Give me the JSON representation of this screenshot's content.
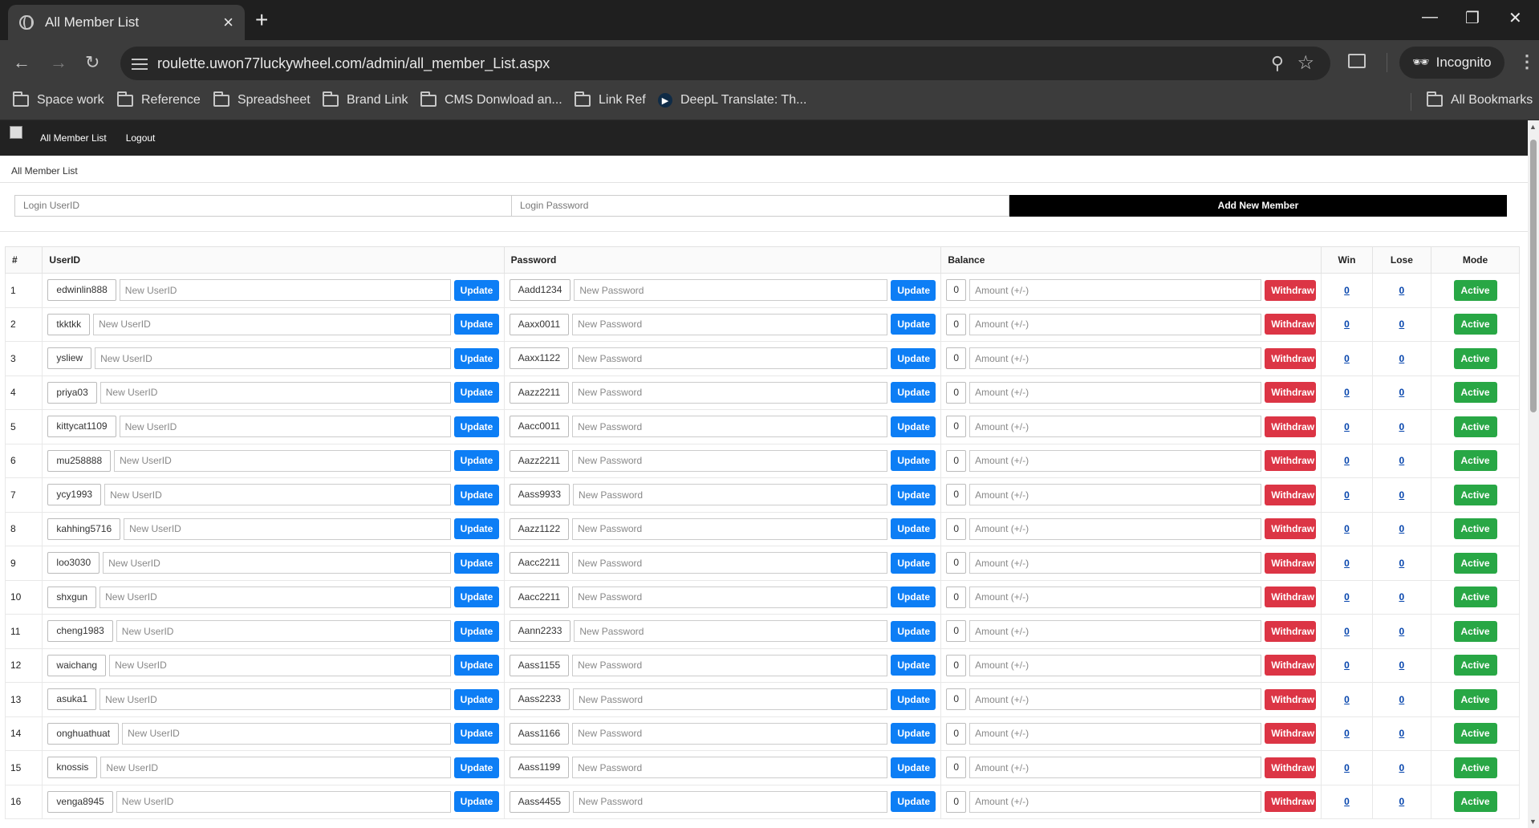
{
  "browser": {
    "tab_title": "All Member List",
    "url": "roulette.uwon77luckywheel.com/admin/all_member_List.aspx",
    "incognito_label": "Incognito",
    "bookmarks": [
      "Space work",
      "Reference",
      "Spreadsheet",
      "Brand Link",
      "CMS Donwload an...",
      "Link Ref",
      "DeepL Translate: Th..."
    ],
    "all_bookmarks_label": "All Bookmarks"
  },
  "app": {
    "nav": [
      "All Member List",
      "Logout"
    ],
    "breadcrumb": "All Member List",
    "add_form": {
      "userid_placeholder": "Login UserID",
      "password_placeholder": "Login Password",
      "add_button": "Add New Member"
    },
    "table": {
      "headers": [
        "#",
        "UserID",
        "Password",
        "Balance",
        "Win",
        "Lose",
        "Mode"
      ],
      "placeholders": {
        "userid": "New UserID",
        "password": "New Password",
        "amount": "Amount (+/-)"
      },
      "labels": {
        "update": "Update",
        "withdraw": "Withdraw",
        "mode": "Active"
      },
      "rows": [
        {
          "no": "1",
          "userid": "edwinlin888",
          "password": "Aadd1234",
          "balance": "0",
          "win": "0",
          "lose": "0"
        },
        {
          "no": "2",
          "userid": "tkktkk",
          "password": "Aaxx0011",
          "balance": "0",
          "win": "0",
          "lose": "0"
        },
        {
          "no": "3",
          "userid": "ysliew",
          "password": "Aaxx1122",
          "balance": "0",
          "win": "0",
          "lose": "0"
        },
        {
          "no": "4",
          "userid": "priya03",
          "password": "Aazz2211",
          "balance": "0",
          "win": "0",
          "lose": "0"
        },
        {
          "no": "5",
          "userid": "kittycat1109",
          "password": "Aacc0011",
          "balance": "0",
          "win": "0",
          "lose": "0"
        },
        {
          "no": "6",
          "userid": "mu258888",
          "password": "Aazz2211",
          "balance": "0",
          "win": "0",
          "lose": "0"
        },
        {
          "no": "7",
          "userid": "ycy1993",
          "password": "Aass9933",
          "balance": "0",
          "win": "0",
          "lose": "0"
        },
        {
          "no": "8",
          "userid": "kahhing5716",
          "password": "Aazz1122",
          "balance": "0",
          "win": "0",
          "lose": "0"
        },
        {
          "no": "9",
          "userid": "loo3030",
          "password": "Aacc2211",
          "balance": "0",
          "win": "0",
          "lose": "0"
        },
        {
          "no": "10",
          "userid": "shxgun",
          "password": "Aacc2211",
          "balance": "0",
          "win": "0",
          "lose": "0"
        },
        {
          "no": "11",
          "userid": "cheng1983",
          "password": "Aann2233",
          "balance": "0",
          "win": "0",
          "lose": "0"
        },
        {
          "no": "12",
          "userid": "waichang",
          "password": "Aass1155",
          "balance": "0",
          "win": "0",
          "lose": "0"
        },
        {
          "no": "13",
          "userid": "asuka1",
          "password": "Aass2233",
          "balance": "0",
          "win": "0",
          "lose": "0"
        },
        {
          "no": "14",
          "userid": "onghuathuat",
          "password": "Aass1166",
          "balance": "0",
          "win": "0",
          "lose": "0"
        },
        {
          "no": "15",
          "userid": "knossis",
          "password": "Aass1199",
          "balance": "0",
          "win": "0",
          "lose": "0"
        },
        {
          "no": "16",
          "userid": "venga8945",
          "password": "Aass4455",
          "balance": "0",
          "win": "0",
          "lose": "0"
        }
      ]
    }
  },
  "colors": {
    "update": "#0d7ef5",
    "withdraw": "#dc3545",
    "active": "#28a745",
    "nav_bg": "#222222"
  }
}
